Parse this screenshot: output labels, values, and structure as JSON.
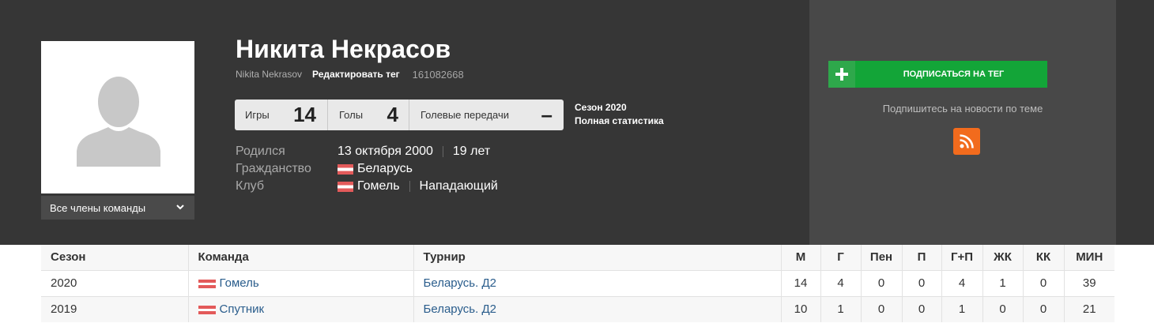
{
  "profile": {
    "name": "Никита Некрасов",
    "latin_name": "Nikita Nekrasov",
    "edit_tag": "Редактировать тег",
    "id": "161082668",
    "team_members": "Все члены команды"
  },
  "stats": {
    "games_label": "Игры",
    "games_value": "14",
    "goals_label": "Голы",
    "goals_value": "4",
    "assists_label": "Голевые передачи",
    "assists_value": "–",
    "season_label": "Сезон 2020",
    "full_stats_label": "Полная статистика"
  },
  "info": {
    "born_label": "Родился",
    "born_date": "13 октября 2000",
    "age": "19 лет",
    "citizenship_label": "Гражданство",
    "citizenship": "Беларусь",
    "club_label": "Клуб",
    "club": "Гомель",
    "position": "Нападающий"
  },
  "subscribe": {
    "button_label": "ПОДПИСАТЬСЯ НА ТЕГ",
    "hint": "Подпишитесь на новости по теме"
  },
  "table": {
    "headers": {
      "season": "Сезон",
      "team": "Команда",
      "tournament": "Турнир",
      "m": "М",
      "g": "Г",
      "pen": "Пен",
      "p": "П",
      "gp": "Г+П",
      "yc": "ЖК",
      "rc": "КК",
      "min": "МИН"
    },
    "rows": [
      {
        "season": "2020",
        "team": "Гомель",
        "tournament": "Беларусь. Д2",
        "m": "14",
        "g": "4",
        "pen": "0",
        "p": "0",
        "gp": "4",
        "yc": "1",
        "rc": "0",
        "min": "39"
      },
      {
        "season": "2019",
        "team": "Спутник",
        "tournament": "Беларусь. Д2",
        "m": "10",
        "g": "1",
        "pen": "0",
        "p": "0",
        "gp": "1",
        "yc": "0",
        "rc": "0",
        "min": "21"
      }
    ]
  },
  "colors": {
    "header_bg": "#363636",
    "side_panel_bg": "#484848",
    "subscribe_green": "#13a538",
    "rss_orange": "#f26b1d",
    "link_blue": "#2a5d8c"
  },
  "icons": {
    "avatar": "person-silhouette-icon",
    "dropdown": "chevron-down-icon",
    "subscribe": "plus-icon",
    "rss": "rss-icon",
    "flag": "belarus-flag-icon"
  }
}
